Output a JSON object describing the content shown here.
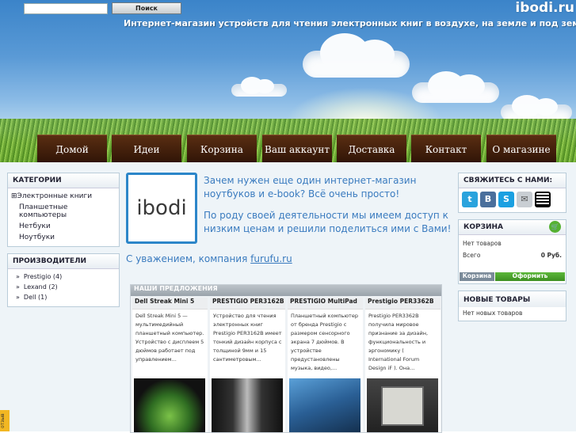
{
  "header": {
    "search_placeholder": "",
    "search_button": "Поиск",
    "logo": "ibodi.ru",
    "tagline": "Интернет-магазин устройств для чтения электронных книг в воздухе, на земле и под землёй"
  },
  "nav": {
    "items": [
      {
        "label": "Домой"
      },
      {
        "label": "Идеи"
      },
      {
        "label": "Корзина"
      },
      {
        "label": "Ваш аккаунт"
      },
      {
        "label": "Доставка"
      },
      {
        "label": "Контакт"
      },
      {
        "label": "О магазине"
      }
    ]
  },
  "sidebar_left": {
    "categories_title": "КАТЕГОРИИ",
    "categories": [
      {
        "label": "Электронные книги",
        "expand": "⊞"
      },
      {
        "label": "Планшетные компьютеры"
      },
      {
        "label": "Нетбуки"
      },
      {
        "label": "Ноутбуки"
      }
    ],
    "manufacturers_title": "ПРОИЗВОДИТЕЛИ",
    "manufacturers": [
      {
        "label": "Prestigio (4)"
      },
      {
        "label": "Lexand (2)"
      },
      {
        "label": "Dell (1)"
      }
    ]
  },
  "main": {
    "logo_text": "ibodi",
    "intro_1": "Зачем нужен еще один интернет-магазин ноутбуков и e-book? Всё очень просто!",
    "intro_2": "По роду своей деятельности мы имеем доступ к низким ценам и решили поделиться ими с Вами!",
    "sign_prefix": "С уважением, компания",
    "sign_link": "furufu.ru",
    "offers_title": "НАШИ ПРЕДЛОЖЕНИЯ",
    "offers": [
      {
        "title": "Dell Streak Mini 5",
        "desc": "Dell Streak Mini 5 — мультимедийный планшетный компьютер. Устройство с дисплеем 5 дюймов работает под управлением..."
      },
      {
        "title": "PRESTIGIO PER3162B",
        "desc": "Устройство для чтения электронных книг Prestigio PER3162B имеет тонкий дизайн корпуса с толщиной 9мм и 15 сантиметровым..."
      },
      {
        "title": "PRESTIGIO MultiPad",
        "desc": "Планшетный компьютер от бренда Prestigio с размером сенсорного экрана 7 дюймов. В устройстве предустановлены музыка, видео,..."
      },
      {
        "title": "Prestigio PER3362B",
        "desc": "Prestigio PER3362B получила мировое признание за дизайн, функциональность и эргономику ( International Forum Design iF ). Она..."
      }
    ]
  },
  "sidebar_right": {
    "contact_title": "СВЯЖИТЕСЬ С НАМИ:",
    "social": [
      {
        "icon": "twitter-icon",
        "glyph": "t",
        "color": "#2aa3dd"
      },
      {
        "icon": "vkontakte-icon",
        "glyph": "B",
        "color": "#4a6f9c"
      },
      {
        "icon": "skype-icon",
        "glyph": "S",
        "color": "#1ba0e1"
      },
      {
        "icon": "email-icon",
        "glyph": "✉",
        "color": "#c9ced3"
      },
      {
        "icon": "qr-code-icon",
        "glyph": "",
        "color": "#000000"
      }
    ],
    "cart_title": "КОРЗИНА",
    "cart_empty": "Нет товаров",
    "cart_total_label": "Всего",
    "cart_total_value": "0 Руб.",
    "cart_button": "Корзина",
    "checkout_button": "Оформить",
    "new_title": "НОВЫЕ ТОВАРЫ",
    "new_empty": "Нет новых товаров"
  },
  "feedback_tab": "отзыв"
}
